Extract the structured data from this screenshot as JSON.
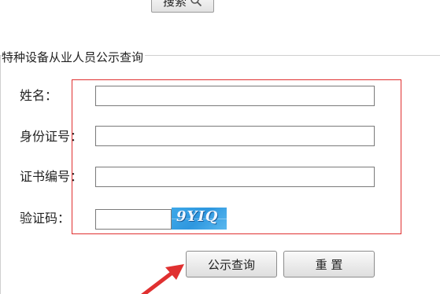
{
  "top_search": {
    "label": "搜索",
    "icon": "search-icon"
  },
  "panel": {
    "title": "特种设备从业人员公示查询"
  },
  "form": {
    "name_label": "姓名：",
    "name_value": "",
    "id_label": "身份证号：",
    "id_value": "",
    "cert_label": "证书编号：",
    "cert_value": "",
    "captcha_label": "验证码：",
    "captcha_value": "",
    "captcha_image_text": "9YIQ"
  },
  "actions": {
    "query_label": "公示查询",
    "reset_label": "重 置"
  },
  "annotations": {
    "highlight_color": "#e03030",
    "arrow_color": "#e03030"
  }
}
